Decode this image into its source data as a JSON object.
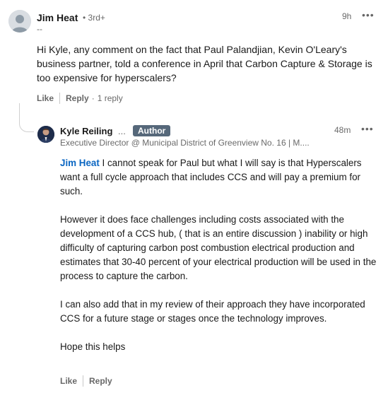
{
  "comment": {
    "author_name": "Jim Heat",
    "degree": "• 3rd+",
    "headline": "--",
    "time": "9h",
    "more_glyph": "•••",
    "body": "Hi Kyle, any comment on the fact that Paul Palandjian, Kevin O'Leary's business partner, told a conference in April that Carbon Capture & Storage is too expensive for hyperscalers?",
    "actions": {
      "like": "Like",
      "reply": "Reply",
      "reply_count": "1 reply"
    }
  },
  "reply": {
    "author_name": "Kyle Reiling",
    "name_ellipsis": "...",
    "badge": "Author",
    "headline": "Executive Director @ Municipal District of Greenview No. 16 | M....",
    "time": "48m",
    "more_glyph": "•••",
    "mention": "Jim Heat",
    "p1_rest": " I cannot speak for Paul but what I will say is that Hyperscalers want a full cycle approach that includes CCS and will pay a premium for such.",
    "p2": "However it does face challenges including costs associated with the development of a CCS hub, ( that is an entire discussion ) inability or high difficulty of capturing carbon post combustion electrical production and estimates that 30-40 percent of your electrical production will be used in the process to capture the carbon.",
    "p3": "I can also add that in my review of their approach they have incorporated CCS for a future stage or stages once the technology improves.",
    "p4": "Hope this helps",
    "actions": {
      "like": "Like",
      "reply": "Reply"
    }
  },
  "colors": {
    "mention": "#0a66c2",
    "badge_bg": "#56687a",
    "meta_text": "#666666"
  }
}
